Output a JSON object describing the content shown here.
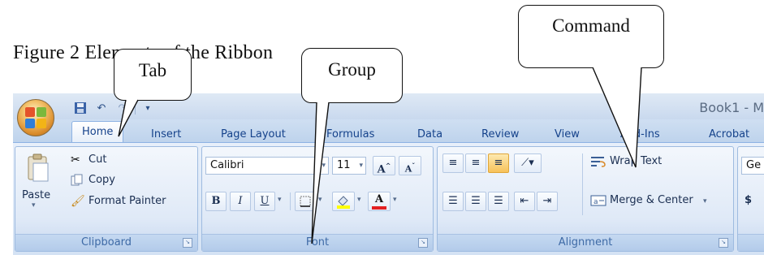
{
  "caption": "Figure 2 Elements of the Ribbon",
  "callouts": {
    "command": "Command",
    "tab": "Tab",
    "group": "Group"
  },
  "window": {
    "doc_title": "Book1 - M",
    "quick_access": [
      "save-icon",
      "undo-icon",
      "redo-icon",
      "customize-qat-icon"
    ]
  },
  "tabs": [
    "Home",
    "Insert",
    "Page Layout",
    "Formulas",
    "Data",
    "Review",
    "View",
    "Add-Ins",
    "Acrobat"
  ],
  "ribbon": {
    "clipboard": {
      "label": "Clipboard",
      "paste": "Paste",
      "cut": "Cut",
      "copy": "Copy",
      "format_painter": "Format Painter"
    },
    "font": {
      "label": "Font",
      "font_name": "Calibri",
      "font_size": "11",
      "bold": "B",
      "italic": "I",
      "underline": "U",
      "increase_size": "A",
      "decrease_size": "A",
      "font_color": "A"
    },
    "alignment": {
      "label": "Alignment",
      "wrap_text": "Wrap Text",
      "merge_center": "Merge & Center"
    },
    "number": {
      "format": "Ge",
      "currency": "$"
    }
  },
  "colors": {
    "ribbon_bg": "#dbe7f6",
    "tab_text": "#15428b",
    "group_label": "#3e6aa6",
    "highlight_fill": "#ffff00",
    "font_color_bar": "#e32020"
  }
}
